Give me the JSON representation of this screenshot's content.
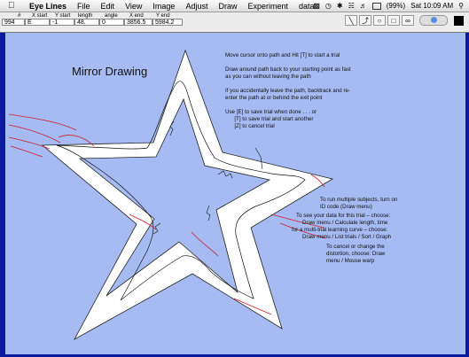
{
  "menubar": {
    "app_name": "Eye Lines",
    "items": [
      "File",
      "Edit",
      "View",
      "Image",
      "Adjust",
      "Draw",
      "Experiment",
      "data"
    ],
    "battery": "(99%)",
    "clock": "Sat 10:09 AM"
  },
  "table": {
    "headers": [
      "#",
      "X start",
      "Y start",
      "length",
      "angle",
      "X end",
      "Y end"
    ],
    "values": [
      "994",
      "E",
      "-1",
      "48.",
      "0",
      "3856.5",
      "5984.2"
    ]
  },
  "canvas": {
    "title": "Mirror  Drawing",
    "instructions_top": "Move cursor onto path and Hit [T] to start a trial\n\nDraw around path back to your starting point as fast\nas you can without leaving the path\n\nIf you accidentally leave the path, backtrack and re-\nenter the path at or behind the exit point\n\nUse [E] to save trial when done . . . or\n      [T] to save trial and start another\n      [Z] to cancel trial",
    "instructions_multi": "To run multiple subjects, turn on\nID code (Draw menu)",
    "instructions_data": "   To see your data for this trial – choose:\n       Draw menu / Calculate length, time\nfor a multi-trial learning curve – choose:\n       Draw menu / List trials / Sort / Graph",
    "instructions_cancel": "To cancel or change the\ndistortion, choose: Draw\nmenu / Mouse warp"
  },
  "colors": {
    "desktop": "#0a1a9e",
    "canvas_bg": "#a5bbf2",
    "star_fill": "#ffffff",
    "trace_black": "#111111",
    "trace_red": "#d41c2c"
  }
}
